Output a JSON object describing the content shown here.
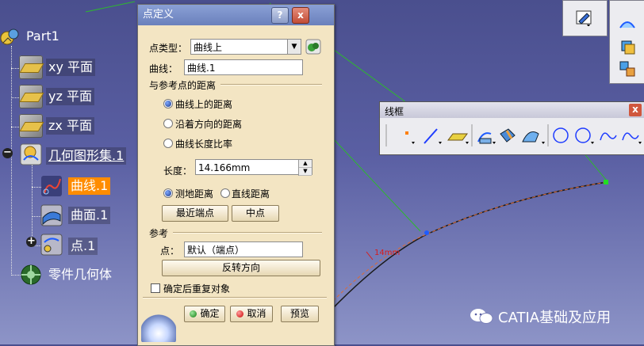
{
  "tree": {
    "root": "Part1",
    "items": [
      {
        "label": "xy 平面"
      },
      {
        "label": "yz 平面"
      },
      {
        "label": "zx 平面"
      },
      {
        "label": "几何图形集.1"
      },
      {
        "label": "曲线.1"
      },
      {
        "label": "曲面.1"
      },
      {
        "label": "点.1"
      },
      {
        "label": "零件几何体"
      }
    ]
  },
  "dialog": {
    "title": "点定义",
    "help_btn": "?",
    "close_btn": "x",
    "point_type_label": "点类型：",
    "point_type_value": "曲线上",
    "curve_label": "曲线：",
    "curve_value": "曲线.1",
    "distance_section": "与参考点的距离",
    "radio_on_curve": "曲线上的距离",
    "radio_along_dir": "沿着方向的距离",
    "radio_ratio": "曲线长度比率",
    "length_label": "长度：",
    "length_value": "14.166mm",
    "radio_geodesic": "测地距离",
    "radio_straight": "直线距离",
    "nearest_end_btn": "最近端点",
    "midpoint_btn": "中点",
    "reference_section": "参考",
    "point_label": "点：",
    "point_value": "默认（端点）",
    "reverse_btn": "反转方向",
    "repeat_checkbox": "确定后重复对象",
    "ok_btn": "确定",
    "cancel_btn": "取消",
    "preview_btn": "预览"
  },
  "wireframe_toolbar": {
    "title": "线框",
    "close_btn": "x"
  },
  "watermark": "CATIA基础及应用",
  "colors": {
    "background": "#5a5fa3",
    "dialog_bg": "#f3e5c3",
    "selected": "#ff8c00",
    "curve_line": "#1a1a1a",
    "frame_line": "#2eb82e"
  }
}
